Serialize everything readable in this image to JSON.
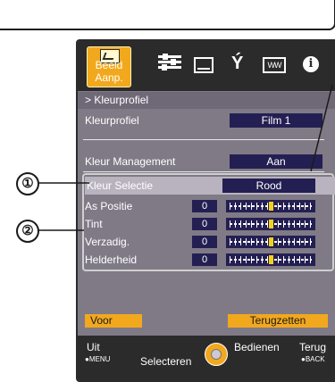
{
  "tabs": {
    "active_label": "Beeld Aanp.",
    "icons": [
      "picture-icon",
      "adjust-icon",
      "screen-icon",
      "wrench-icon",
      "battery-icon",
      "info-icon"
    ],
    "battery_text": "WW",
    "info_text": "i"
  },
  "breadcrumb": "> Kleurprofiel",
  "rows": {
    "kleurprofiel": {
      "label": "Kleurprofiel",
      "value": "Film 1"
    },
    "kleur_management": {
      "label": "Kleur Management",
      "value": "Aan"
    },
    "kleur_selectie": {
      "label": "Kleur Selectie",
      "value": "Rood"
    }
  },
  "sliders": [
    {
      "label": "As Positie",
      "value": "0"
    },
    {
      "label": "Tint",
      "value": "0"
    },
    {
      "label": "Verzadig.",
      "value": "0"
    },
    {
      "label": "Helderheid",
      "value": "0"
    }
  ],
  "buttons": {
    "voor": "Voor",
    "terugzetten": "Terugzetten"
  },
  "footer": {
    "uit": "Uit",
    "menu": "●MENU",
    "selecteren": "Selecteren",
    "bedienen": "Bedienen",
    "terug": "Terug",
    "back": "●BACK"
  },
  "callouts": [
    "①",
    "②"
  ],
  "colors": {
    "accent": "#f2a81d",
    "panel": "#807a87",
    "value_box": "#241f52",
    "bar": "#2b2b2b"
  }
}
